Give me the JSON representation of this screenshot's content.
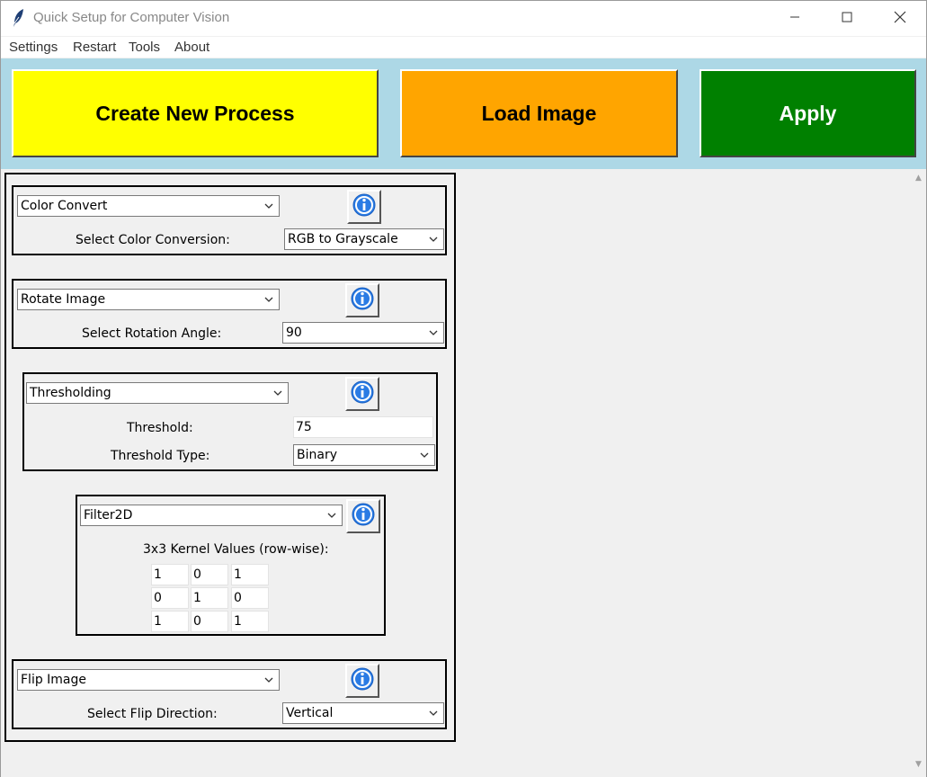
{
  "window": {
    "title": "Quick Setup for Computer Vision",
    "icon": "feather-icon",
    "controls": [
      "minimize-icon",
      "maximize-icon",
      "close-icon"
    ]
  },
  "menu": {
    "items": [
      "Settings",
      "Restart",
      "Tools",
      "About"
    ]
  },
  "toolbar": {
    "create_label": "Create New Process",
    "load_label": "Load Image",
    "apply_label": "Apply",
    "colors": {
      "background": "#add8e6",
      "create": "#ffff00",
      "load": "#ffa500",
      "apply": "#008000"
    }
  },
  "panels": {
    "color_convert": {
      "process": "Color Convert",
      "param_label": "Select Color Conversion:",
      "param_value": "RGB to Grayscale"
    },
    "rotate": {
      "process": "Rotate Image",
      "param_label": "Select Rotation Angle:",
      "param_value": "90"
    },
    "threshold": {
      "process": "Thresholding",
      "threshold_label": "Threshold:",
      "threshold_value": "75",
      "type_label": "Threshold Type:",
      "type_value": "Binary"
    },
    "filter2d": {
      "process": "Filter2D",
      "kernel_label": "3x3 Kernel Values (row-wise):",
      "kernel": [
        [
          "1",
          "0",
          "1"
        ],
        [
          "0",
          "1",
          "0"
        ],
        [
          "1",
          "0",
          "1"
        ]
      ]
    },
    "flip": {
      "process": "Flip Image",
      "param_label": "Select Flip Direction:",
      "param_value": "Vertical"
    }
  },
  "icons": {
    "info": "info-icon",
    "dropdown": "chevron-down-icon"
  }
}
